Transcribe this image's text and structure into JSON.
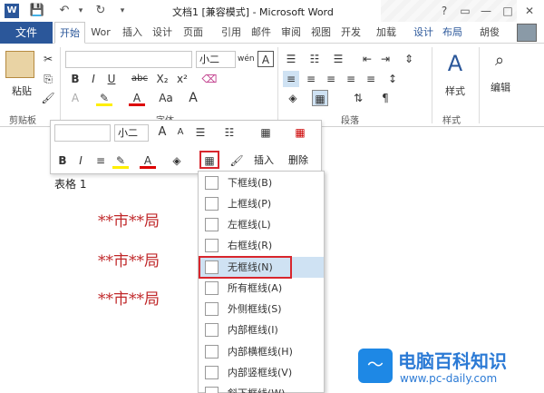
{
  "title_bar": {
    "title": "文档1 [兼容模式] - Microsoft Word",
    "qa_save": "💾",
    "qa_undo": "↶",
    "qa_redo": "↻",
    "help": "?",
    "min": "—",
    "max": "□",
    "close": "✕",
    "restore": "▭"
  },
  "tabs": {
    "file": "文件",
    "items": [
      "开始",
      "Wor",
      "插入",
      "设计",
      "页面",
      "引用",
      "邮件",
      "审阅",
      "视图",
      "开发",
      "加载",
      "设计",
      "布局"
    ],
    "user": "胡俊"
  },
  "ribbon": {
    "paste": "粘贴",
    "font_name": "",
    "font_size": "小二",
    "wen": "wén",
    "a_box": "A",
    "b": "B",
    "i": "I",
    "u": "U",
    "abc": "abc",
    "x2": "X₂",
    "x2sup": "x²",
    "font_color": "A",
    "aa": "Aa",
    "a_big": "A",
    "style_btn": "样式",
    "edit_btn": "编辑",
    "group_clipboard": "剪贴板",
    "group_font": "字体",
    "group_para": "段落",
    "group_style": "样式"
  },
  "mini_toolbar": {
    "font_name": "",
    "font_size": "小二",
    "grow": "A",
    "shrink": "A",
    "b": "B",
    "i": "I",
    "insert": "插入",
    "delete": "删除"
  },
  "document": {
    "table_caption": "表格 1",
    "lines": [
      "**市**局",
      "**市**局",
      "**市**局"
    ]
  },
  "menu": {
    "items": [
      "下框线(B)",
      "上框线(P)",
      "左框线(L)",
      "右框线(R)",
      "无框线(N)",
      "所有框线(A)",
      "外侧框线(S)",
      "内部框线(I)",
      "内部横框线(H)",
      "内部竖框线(V)",
      "斜下框线(W)"
    ],
    "highlighted_index": 4
  },
  "watermark": {
    "name": "电脑百科知识",
    "url": "www.pc-daily.com"
  },
  "colors": {
    "file_tab": "#2b579a",
    "red_text": "#c0282a",
    "highlight": "#cfe2f3",
    "red_box": "#d8262d"
  }
}
